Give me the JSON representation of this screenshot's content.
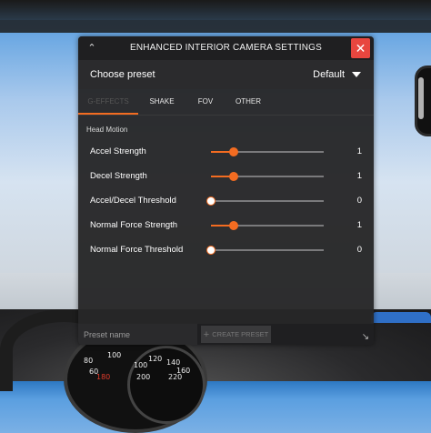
{
  "window": {
    "title": "ENHANCED INTERIOR CAMERA SETTINGS"
  },
  "preset": {
    "label": "Choose preset",
    "selected": "Default"
  },
  "tabs": [
    {
      "label": "G-EFFECTS",
      "active": true
    },
    {
      "label": "SHAKE",
      "active": false
    },
    {
      "label": "FOV",
      "active": false
    },
    {
      "label": "OTHER",
      "active": false
    }
  ],
  "section_title": "Head Motion",
  "sliders": [
    {
      "label": "Accel Strength",
      "value": "1",
      "fill_fraction": 0.2
    },
    {
      "label": "Decel Strength",
      "value": "1",
      "fill_fraction": 0.2
    },
    {
      "label": "Accel/Decel Threshold",
      "value": "0",
      "fill_fraction": 0.0
    },
    {
      "label": "Normal Force Strength",
      "value": "1",
      "fill_fraction": 0.2
    },
    {
      "label": "Normal Force Threshold",
      "value": "0",
      "fill_fraction": 0.0
    }
  ],
  "footer": {
    "preset_name_placeholder": "Preset name",
    "create_label": "CREATE PRESET"
  },
  "icons": {
    "collapse": "chevron-up-icon",
    "close": "close-icon",
    "dropdown": "caret-down-icon",
    "create": "plus-icon",
    "resize": "resize-icon"
  },
  "gauge_numbers": [
    "80",
    "60",
    "100",
    "100",
    "120",
    "140",
    "160",
    "180",
    "200",
    "220"
  ],
  "colors": {
    "accent": "#f36c21",
    "close_button": "#e8463f",
    "panel_bg": "#262628"
  }
}
